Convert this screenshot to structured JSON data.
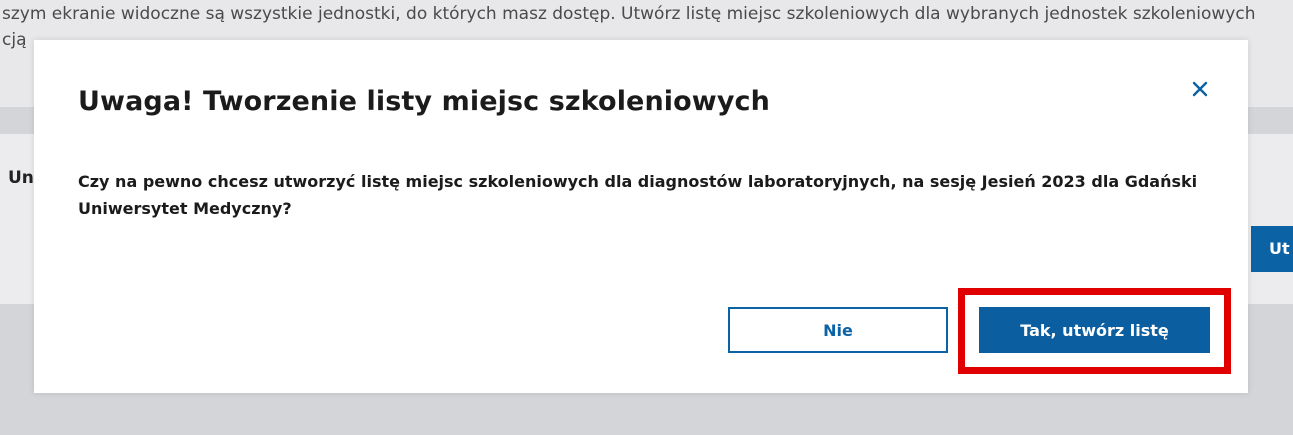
{
  "background": {
    "info_line_1": "szym ekranie widoczne są wszystkie jednostki, do których masz dostęp. Utwórz listę miejsc szkoleniowych dla wybranych jednostek szkoleniowych",
    "info_line_2": "cją",
    "section_label": "Un",
    "action_button_label": "Ut"
  },
  "dialog": {
    "title": "Uwaga! Tworzenie listy miejsc szkoleniowych",
    "message": "Czy na pewno chcesz utworzyć listę miejsc szkoleniowych dla diagnostów laboratoryjnych, na sesję Jesień 2023 dla Gdański Uniwersytet Medyczny?",
    "close_icon": "close-icon",
    "no_label": "Nie",
    "yes_label": "Tak, utwórz listę"
  },
  "colors": {
    "primary": "#0b5ea0",
    "highlight": "#e00000",
    "overlay": "#d4d5d8"
  }
}
